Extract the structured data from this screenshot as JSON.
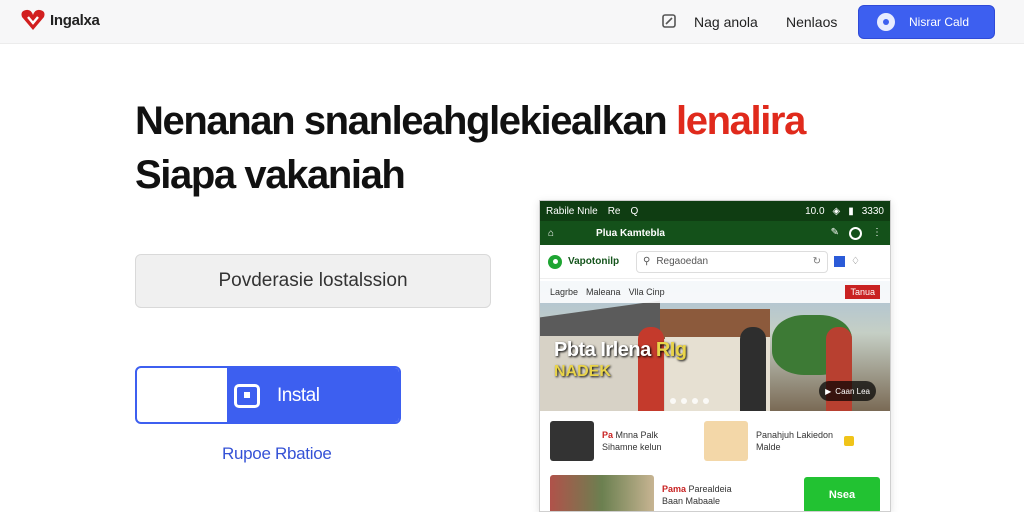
{
  "header": {
    "logo_text": "Ingalxa",
    "nav_links": [
      "Nag anola",
      "Nenlaos"
    ],
    "cta_label": "Nisrar Cald"
  },
  "hero": {
    "headline_part1": "Nenanan snanleahglekiealkan",
    "headline_accent": "lenalira",
    "headline_line2": "Siapa vakaniah",
    "field_text": "Povderasie lostalssion",
    "install_label": "Instal",
    "sub_link": "Rupoe Rbatioe"
  },
  "phone": {
    "status_left": [
      "Rabile Nnle",
      "Re",
      "Q"
    ],
    "status_right": [
      "10.0",
      "3330"
    ],
    "app_title": "Plua Kamtebla",
    "brand_name": "Vapotonilp",
    "search_placeholder": "Regaoedan",
    "banner_strip": [
      "Lagrbe",
      "Maleana",
      "Vlla Cinp",
      "Tanua"
    ],
    "banner_headline": "Pbta Irlena",
    "banner_headline_accent": "RIg",
    "banner_headline2": "NADEK",
    "play_badge": "Caan Lea",
    "card1": {
      "tag": "Pa",
      "text": "Mnna Palk Sihamne kelun"
    },
    "card2": {
      "tag": "",
      "text": "Panahjuh Lakiedon Malde"
    },
    "card3": {
      "tag": "Pama",
      "text": "Parealdeia Baan Mabaale"
    },
    "green_label": "Nsea"
  },
  "colors": {
    "brand_blue": "#3d5ff0",
    "accent_red": "#e02a1c",
    "phone_green": "#14511a",
    "button_green": "#22c232"
  }
}
